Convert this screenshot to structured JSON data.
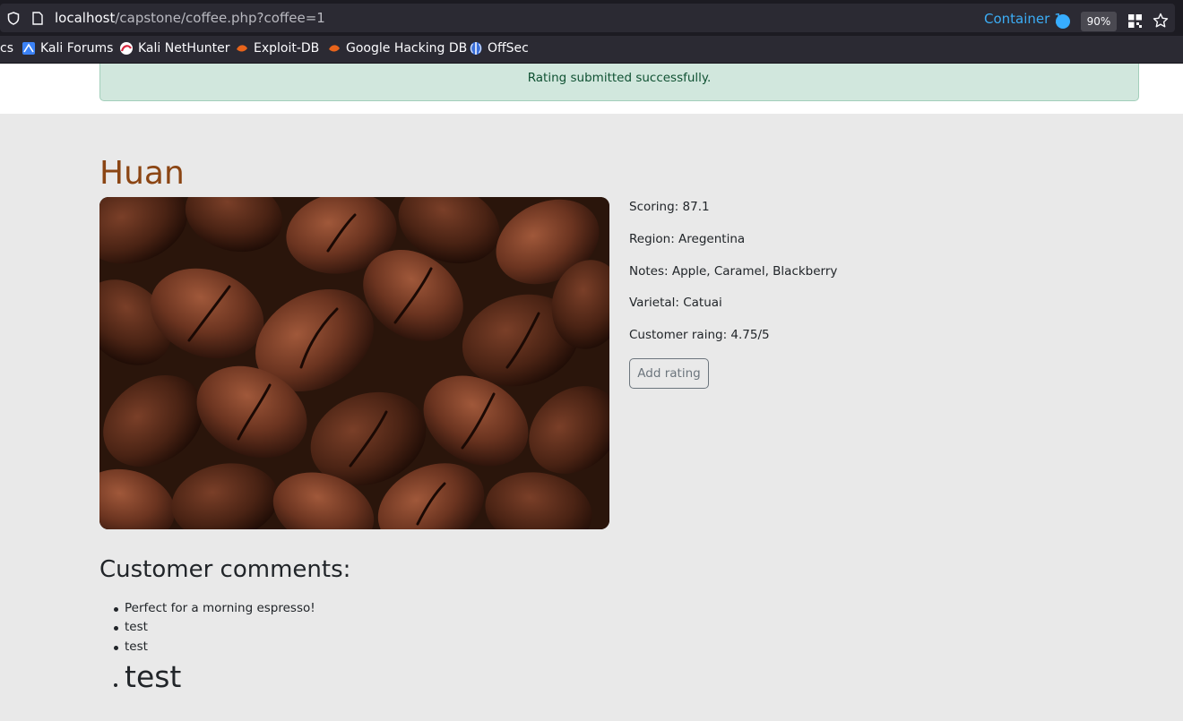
{
  "browser": {
    "url_host": "localhost",
    "url_path": "/capstone/coffee.php?coffee=1",
    "container_label": "Container 1",
    "zoom_level": "90%",
    "colors": {
      "container": "#37adff"
    }
  },
  "bookmarks": [
    {
      "label": "cs",
      "icon": ""
    },
    {
      "label": "Kali Forums",
      "icon": "kali-forums-icon"
    },
    {
      "label": "Kali NetHunter",
      "icon": "kali-nethunter-icon"
    },
    {
      "label": "Exploit-DB",
      "icon": "exploit-db-icon"
    },
    {
      "label": "Google Hacking DB",
      "icon": "google-hacking-db-icon"
    },
    {
      "label": "OffSec",
      "icon": "offsec-icon"
    }
  ],
  "alert": {
    "message": "Rating submitted successfully."
  },
  "coffee": {
    "name": "Huan",
    "details": {
      "scoring": "Scoring: 87.1",
      "region": "Region: Aregentina",
      "notes": "Notes: Apple, Caramel, Blackberry",
      "varietal": "Varietal: Catuai",
      "customer_rating": "Customer raing: 4.75/5"
    },
    "add_rating_label": "Add rating"
  },
  "comments": {
    "title": "Customer comments:",
    "items": [
      "Perfect for a morning espresso!",
      "test",
      "test",
      "test"
    ]
  }
}
